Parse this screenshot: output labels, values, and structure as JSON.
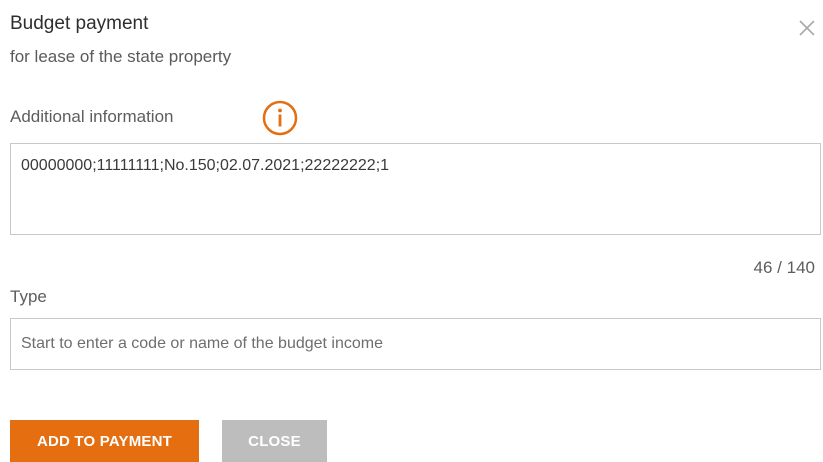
{
  "dialog": {
    "title": "Budget payment",
    "subtitle": "for lease of the state property",
    "close_icon": "close-icon"
  },
  "additional_info": {
    "label": "Additional information",
    "info_icon": "info-icon",
    "value": "00000000;11111111;No.150;02.07.2021;22222222;1",
    "counter": "46 / 140"
  },
  "type_field": {
    "label": "Type",
    "placeholder": "Start to enter a code or name of the budget income",
    "value": ""
  },
  "buttons": {
    "add_label": "ADD TO PAYMENT",
    "close_label": "CLOSE"
  },
  "colors": {
    "accent": "#e56e11",
    "disabled_button": "#bdbdbd",
    "border": "#c9c9c9",
    "close_icon": "#a9a9a9"
  }
}
